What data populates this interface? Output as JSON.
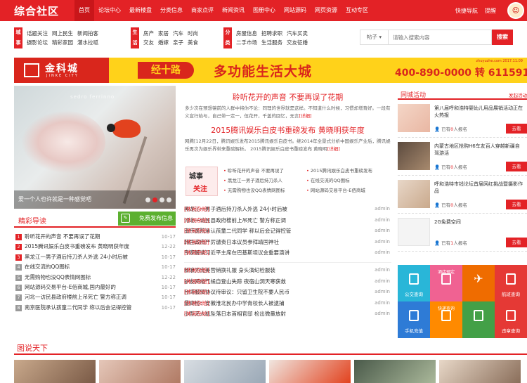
{
  "header": {
    "logo": "综合社区",
    "nav": [
      "首页",
      "论坛中心",
      "最新楼盘",
      "分类信息",
      "商家点评",
      "新闻资讯",
      "图册中心",
      "网站源码",
      "网页资源",
      "互动专区"
    ],
    "active_index": 0,
    "quick_nav": "快捷导航",
    "mention": "提醒",
    "avatar_badge": "头像"
  },
  "categories": [
    {
      "tag": "城事",
      "links": [
        "话题关注",
        "网上民生",
        "新闻拍客",
        "摄影论坛",
        "精彩家园",
        "灌水拉呱"
      ]
    },
    {
      "tag": "生活",
      "links": [
        "房产",
        "家居",
        "汽车",
        "时尚",
        "交友",
        "婚嫁",
        "亲子",
        "美食"
      ]
    },
    {
      "tag": "分类",
      "links": [
        "房屋信息",
        "招聘求职",
        "汽车买卖",
        "二手市场",
        "生活服务",
        "交友征婚"
      ]
    }
  ],
  "search": {
    "scope": "帖子",
    "placeholder": "请输入搜索内容",
    "button": "搜索"
  },
  "banner": {
    "brand_cn": "金科城",
    "brand_en": "JINKE CITY",
    "road": "经十路",
    "slogan": "多功能生活大城",
    "phone": "400-890-0000 转 611591",
    "url": "zhuyuzhe.com 2017.11.09"
  },
  "hero": {
    "watermark": "sedro ferrinno",
    "caption": "爱一个人也许就是一种感觉吧",
    "slides": 4,
    "active_slide": 1
  },
  "headlines": [
    {
      "title": "聆听花开的声音 不要再误了花期",
      "summary": "多少次在预想镜前的人群中将你不论：同理的世界就是这样。不知道什么时候，习惯却增育好。一段有义宣行始与，自己带一定一，伍花开，千盖的回忆，无言",
      "more": "[详细]"
    },
    {
      "title": "2015腾讯娱乐白皮书重磅发布 黄晓明获年度",
      "summary": "网腾[12月22日，腾讯娱乐发布2015腾讯娱乐白皮书。继2014年全景式分析中国娱乐产业后，腾讯娱乐再次为娱乐界带来重磅解析。 2015腾讯娱乐白皮书重磅发布 黄晓明",
      "more": "[详细]"
    }
  ],
  "focus": {
    "tag_a": "城事",
    "tag_b": "关注",
    "items": [
      "聆听花开的声音 不要再误了",
      "2015腾讯娱乐白皮书重磅发布",
      "黑龙江一男子酒后持刀杀人",
      "在线交流的QQ图标",
      "无需购物也没QQ表情网图标",
      "网站源码交易平台-E佰商城"
    ]
  },
  "news": [
    {
      "cat": "[休闲杂烩]",
      "title": "黑龙江一男子酒后持刀杀人外逃 24小时后被",
      "author": "admin"
    },
    {
      "cat": "[休闲杂烩]",
      "title": "河北一访民县政府楼前上吊死亡 警方称正调",
      "author": "admin"
    },
    {
      "cat": "[休闲杂烩]",
      "title": "南京医院承认孩童二代同学 称以后会记得控管",
      "author": "admin"
    },
    {
      "cat": "[休闲杂烩]",
      "title": "韩国政府严厉谴责日本议员参拜靖国神社",
      "author": "admin"
    },
    {
      "cat": "[休闲杂烩]",
      "title": "专家解读习近平主席在巴基斯坦议会重要演讲",
      "author": "admin"
    },
    {
      "cat": "[休闲杂烩]",
      "title": "新浪为完美营销换礼服 身头演纪检服装",
      "author": "admin"
    },
    {
      "cat": "[休闲杂烩]",
      "title": "驴友网络气候自登山失踪 夜宿山洞天寒获救",
      "author": "admin"
    },
    {
      "cat": "[休闲杂烩]",
      "title": "台湾服贸协议待审议：只留卫生院不要人民币",
      "author": "admin"
    },
    {
      "cat": "[休闲杂烩]",
      "title": "最高检：安徽淮北民办中学青校长人被逮捕",
      "author": "admin"
    },
    {
      "cat": "[休闲杂烩]",
      "title": "小型无人机坠落日本首相官邸 检出微量放射",
      "author": "admin"
    }
  ],
  "featured": {
    "title": "精彩导读",
    "post_button": "免费发布信息",
    "list": [
      {
        "n": "1",
        "title": "聆听花开的声音 不要再误了花期",
        "date": "10-17"
      },
      {
        "n": "2",
        "title": "2015腾讯娱乐白皮书重磅发布 黄晓明获年度",
        "date": "12-22"
      },
      {
        "n": "3",
        "title": "黑龙江一男子酒后持刀杀人外逃 24小时后被",
        "date": "10-17"
      },
      {
        "n": "4",
        "title": "在线交流的QQ图标",
        "date": "10-17"
      },
      {
        "n": "5",
        "title": "无需购物也没QQ表情网图标",
        "date": "12-22"
      },
      {
        "n": "6",
        "title": "网站源码交易平台-E佰商城,国内最好的",
        "date": "10-17"
      },
      {
        "n": "7",
        "title": "河北一访民县政府楼前上吊死亡 警方称正调",
        "date": "10-17"
      },
      {
        "n": "8",
        "title": "南京医院承认孩童二代同学 称以后会记得控管",
        "date": "10-17"
      }
    ]
  },
  "activities": {
    "title": "同城活动",
    "more": "发起活动",
    "items": [
      {
        "title": "第八届呼和浩特婴幼儿用品展销活动正在火热报",
        "meta_a": "已有",
        "count": "0",
        "meta_b": "人报名",
        "join": "去看"
      },
      {
        "title": "内蒙古地区抢购H6车友百人穿越新疆自驾游活",
        "meta_a": "已有",
        "count": "0",
        "meta_b": "人报名",
        "join": "去看"
      },
      {
        "title": "呼和浩特市钱论坛首届网红挑战暨摄影作品",
        "meta_a": "已有",
        "count": "0",
        "meta_b": "人报名",
        "join": "去看"
      },
      {
        "title": "2G免费空间",
        "meta_a": "已有",
        "count": "1",
        "meta_b": "人报名",
        "join": "去看"
      }
    ]
  },
  "tiles": [
    {
      "label": "公交查询",
      "top": "",
      "color": "#29b6d8"
    },
    {
      "label": "",
      "top": "酒店预定",
      "color": "#f06292"
    },
    {
      "label": "",
      "top": "",
      "color": "#ef6c00"
    },
    {
      "label": "航班查询",
      "top": "",
      "color": "#e53935"
    },
    {
      "label": "手机充值",
      "top": "",
      "color": "#2e7bd6"
    },
    {
      "label": "",
      "top": "快递查询",
      "color": "#ff8a00"
    },
    {
      "label": "",
      "top": "",
      "color": "#43a047"
    },
    {
      "label": "违章查询",
      "top": "",
      "color": "#e53935"
    }
  ],
  "gallery": {
    "title": "图说天下"
  }
}
